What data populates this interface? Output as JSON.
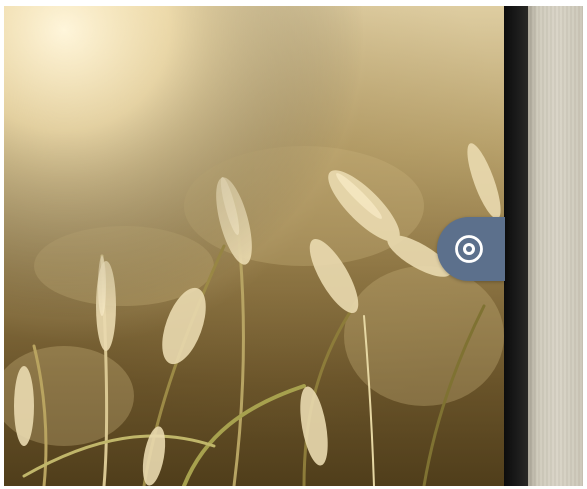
{
  "screen": {
    "description_free": true
  },
  "camera_tab": {
    "icon": "camera-shutter-icon",
    "color": "#5c708c",
    "icon_color": "#ffffff"
  },
  "colors": {
    "bezel": "#111111",
    "side_panel": "#d6d1c3",
    "background": "#ffffff"
  }
}
